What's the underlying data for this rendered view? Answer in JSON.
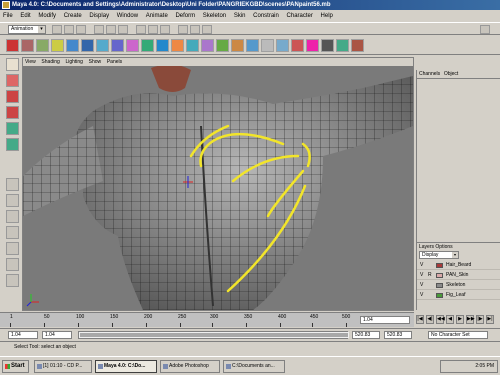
{
  "window": {
    "title": "Maya 4.0: C:\\Documents and Settings\\Administrator\\Desktop\\Uni Folder\\PANGRIEKGBD\\scenes\\PANpaint56.mb"
  },
  "menubar": [
    "File",
    "Edit",
    "Modify",
    "Create",
    "Display",
    "Window",
    "Animate",
    "Deform",
    "Skeleton",
    "Skin",
    "Constrain",
    "Character",
    "Help"
  ],
  "statusline": {
    "mode": "Animation"
  },
  "viewport": {
    "menu": [
      "View",
      "Shading",
      "Lighting",
      "Show",
      "Panels"
    ]
  },
  "channelbox": {
    "tabs": [
      "Channels",
      "Object"
    ]
  },
  "layers": {
    "header": "Layers  Options",
    "selector": "Display",
    "rows": [
      {
        "v": "V",
        "r": "",
        "color": "#a83a3a",
        "name": "Hair_Beard"
      },
      {
        "v": "V",
        "r": "R",
        "color": "#d8a8a8",
        "name": "PAN_Skin"
      },
      {
        "v": "V",
        "r": "",
        "color": "#8a8a8a",
        "name": "Skeleton"
      },
      {
        "v": "V",
        "r": "",
        "color": "#4a9a3a",
        "name": "Fig_Leaf"
      }
    ]
  },
  "timeslider": {
    "ticks": [
      "1",
      "50",
      "100",
      "150",
      "200",
      "250",
      "300",
      "350",
      "400",
      "450",
      "500"
    ],
    "current_frame": "1.04"
  },
  "rangebar": {
    "start": "1.04",
    "inner_start": "1.04",
    "inner_end": "520.83",
    "end": "520.83",
    "character_set": "No Character Set"
  },
  "helpline": {
    "text": "Select Tool: select an object"
  },
  "taskbar": {
    "start": "Start",
    "buttons": [
      "[1] 01:10 - CD P...",
      "Maya 4.0: C:\\Do...",
      "Adobe Photoshop",
      "C:\\Documents an..."
    ],
    "clock": "2:05 PM"
  },
  "colors": {
    "titlebar": "#0a246a",
    "annotation_arrows": "#f2e52a",
    "mesh_wire": "#1a1a1a"
  }
}
